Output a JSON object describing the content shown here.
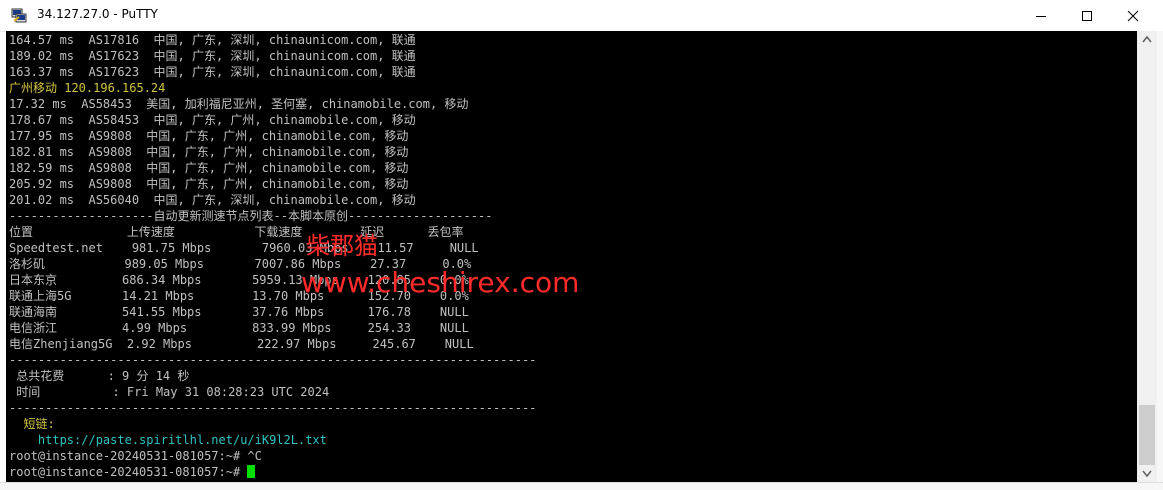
{
  "window": {
    "title": "34.127.27.0 - PuTTY"
  },
  "colors": {
    "terminal_bg": "#000000",
    "text": "#c0c0c0",
    "heading": "#d4c640",
    "link": "#2ec4c4",
    "cursor": "#00e000",
    "watermark": "#ff2a2a"
  },
  "terminal": {
    "lines": [
      "164.57 ms  AS17816  中国, 广东, 深圳, chinaunicom.com, 联通",
      "189.02 ms  AS17623  中国, 广东, 深圳, chinaunicom.com, 联通",
      "163.37 ms  AS17623  中国, 广东, 深圳, chinaunicom.com, 联通",
      "广州移动 120.196.165.24",
      "17.32 ms  AS58453  美国, 加利福尼亚州, 圣何塞, chinamobile.com, 移动",
      "178.67 ms  AS58453  中国, 广东, 广州, chinamobile.com, 移动",
      "177.95 ms  AS9808  中国, 广东, 广州, chinamobile.com, 移动",
      "182.81 ms  AS9808  中国, 广东, 广州, chinamobile.com, 移动",
      "182.59 ms  AS9808  中国, 广东, 广州, chinamobile.com, 移动",
      "205.92 ms  AS9808  中国, 广东, 广州, chinamobile.com, 移动",
      "201.02 ms  AS56040  中国, 广东, 深圳, chinamobile.com, 移动",
      "--------------------自动更新测速节点列表--本脚本原创--------------------",
      "位置             上传速度           下载速度        延迟      丢包率",
      "Speedtest.net    981.75 Mbps       7960.03 Mbps    11.57     NULL",
      "洛杉矶           989.05 Mbps       7007.86 Mbps    27.37     0.0%",
      "日本东京         686.34 Mbps       5959.13 Mbps    120.85    0.0%",
      "联通上海5G       14.21 Mbps        13.70 Mbps      152.70    0.0%",
      "联通海南         541.55 Mbps       37.76 Mbps      176.78    NULL",
      "电信浙江         4.99 Mbps         833.99 Mbps     254.33    NULL",
      "电信Zhenjiang5G  2.92 Mbps         222.97 Mbps     245.67    NULL",
      "-------------------------------------------------------------------------",
      " 总共花费      : 9 分 14 秒",
      " 时间          : Fri May 31 08:28:23 UTC 2024",
      "-------------------------------------------------------------------------",
      "  短链:",
      "    https://paste.spiritlhl.net/u/iK9l2L.txt",
      "root@instance-20240531-081057:~# ^C",
      "root@instance-20240531-081057:~# "
    ]
  },
  "watermark": {
    "name": "柴郡猫",
    "url": "www.cheshirex.com"
  }
}
